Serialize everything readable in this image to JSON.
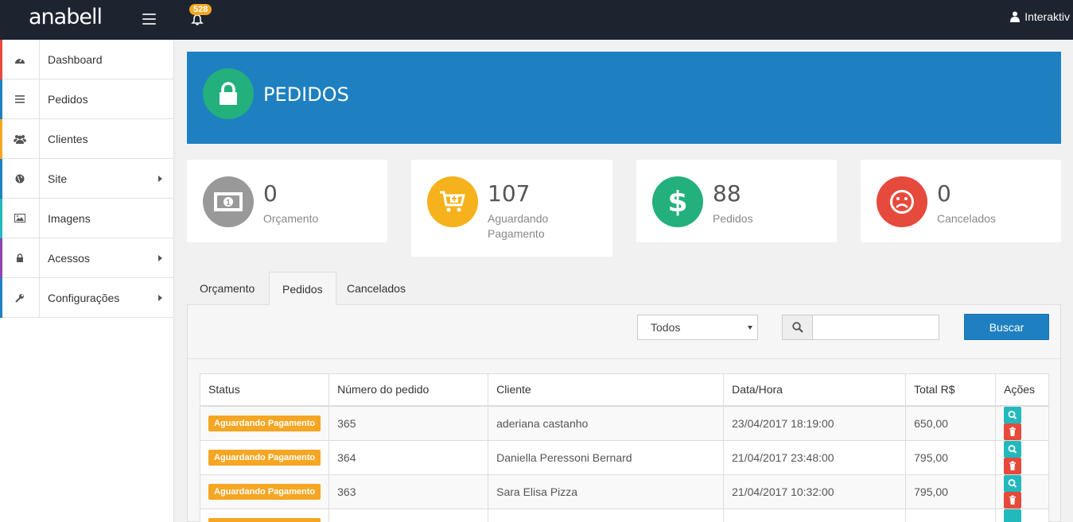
{
  "app": {
    "logo_text": "anabell",
    "notifications_count": "528",
    "user_name": "Interaktiv"
  },
  "sidebar": {
    "items": [
      {
        "label": "Dashboard",
        "icon": "dashboard-icon",
        "color": "#e64a3c",
        "has_submenu": false
      },
      {
        "label": "Pedidos",
        "icon": "list-icon",
        "color": "#1e80c1",
        "has_submenu": false
      },
      {
        "label": "Clientes",
        "icon": "users-icon",
        "color": "#f5a623",
        "has_submenu": false
      },
      {
        "label": "Site",
        "icon": "globe-icon",
        "color": "#1e80c1",
        "has_submenu": true
      },
      {
        "label": "Imagens",
        "icon": "image-icon",
        "color": "#22b9bd",
        "has_submenu": false
      },
      {
        "label": "Acessos",
        "icon": "lock-icon",
        "color": "#8e44ad",
        "has_submenu": true
      },
      {
        "label": "Configurações",
        "icon": "wrench-icon",
        "color": "#1e80c1",
        "has_submenu": true
      }
    ]
  },
  "header": {
    "title": "PEDIDOS",
    "icon": "lock-icon",
    "bg_color": "#1e80c1",
    "icon_bg": "#23b07d"
  },
  "stats": [
    {
      "value": "0",
      "label": "Orçamento",
      "icon": "money-icon",
      "color": "#999999"
    },
    {
      "value": "107",
      "label": "Aguardando Pagamento",
      "icon": "cart-icon",
      "color": "#f5b21c"
    },
    {
      "value": "88",
      "label": "Pedidos",
      "icon": "dollar-icon",
      "color": "#23b07d"
    },
    {
      "value": "0",
      "label": "Cancelados",
      "icon": "frown-icon",
      "color": "#e64a3c"
    }
  ],
  "tabs": [
    {
      "label": "Orçamento",
      "active": false
    },
    {
      "label": "Pedidos",
      "active": true
    },
    {
      "label": "Cancelados",
      "active": false
    }
  ],
  "filters": {
    "select_value": "Todos",
    "search_value": "",
    "search_button": "Buscar"
  },
  "table": {
    "columns": [
      "Status",
      "Número do pedido",
      "Cliente",
      "Data/Hora",
      "Total R$",
      "Ações"
    ],
    "rows": [
      {
        "status": "Aguardando Pagamento",
        "number": "365",
        "client": "aderiana castanho",
        "datetime": "23/04/2017 18:19:00",
        "total": "650,00"
      },
      {
        "status": "Aguardando Pagamento",
        "number": "364",
        "client": "Daniella Peressoni Bernard",
        "datetime": "21/04/2017 23:48:00",
        "total": "795,00"
      },
      {
        "status": "Aguardando Pagamento",
        "number": "363",
        "client": "Sara Elisa Pizza",
        "datetime": "21/04/2017 10:32:00",
        "total": "795,00"
      }
    ]
  }
}
